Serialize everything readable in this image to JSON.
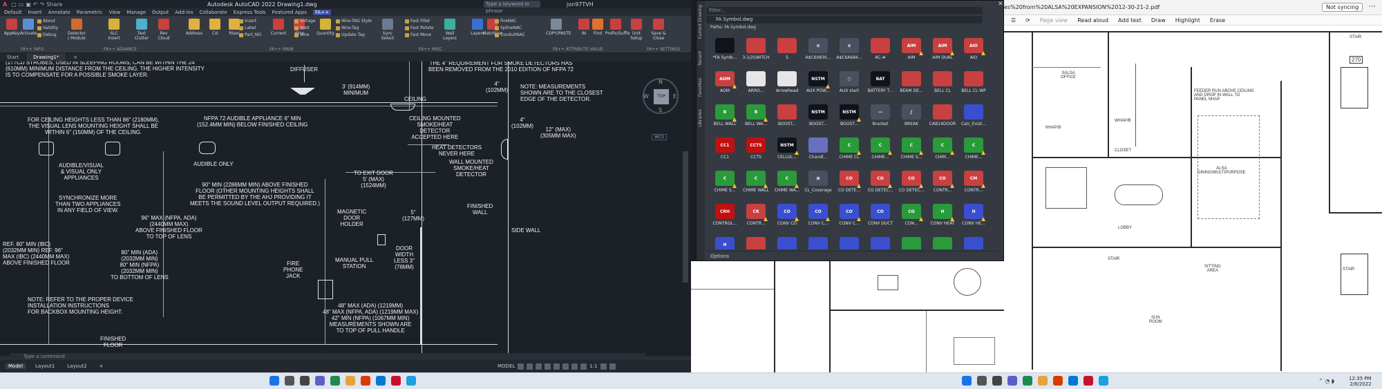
{
  "acad": {
    "title": "Autodesk AutoCAD 2022  Drawing1.dwg",
    "quick_access": [
      "Share"
    ],
    "search_placeholder": "Type a keyword or phrase",
    "user": "jon97TVH",
    "menus": [
      "Default",
      "Insert",
      "Annotate",
      "Parametric",
      "View",
      "Manage",
      "Output",
      "Add-ins",
      "Collaborate",
      "Express Tools",
      "Featured Apps",
      "FA++"
    ],
    "active_menu": "FA++",
    "ribbon_tools": [
      {
        "label": "AppKey",
        "color": "#c94040"
      },
      {
        "label": "Activate",
        "color": "#5a8fd6"
      },
      {
        "label": "Detector / Module",
        "color": "#d46a2b"
      },
      {
        "label": "SLC Insert",
        "color": "#d6b23a"
      },
      {
        "label": "Text Clutter",
        "color": "#4bb0c9"
      },
      {
        "label": "Rev Cloud",
        "color": "#c94040"
      },
      {
        "label": "Address",
        "color": "#e0b040"
      },
      {
        "label": "Cd",
        "color": "#e0b040"
      },
      {
        "label": "Riser",
        "color": "#e0b040"
      },
      {
        "label": "Current",
        "color": "#c94040"
      },
      {
        "label": "Wire",
        "color": "#c94040"
      },
      {
        "label": "Quantity",
        "color": "#d6b23a"
      },
      {
        "label": "Sync Select",
        "color": "#6a7a90"
      },
      {
        "label": "Wall Layers",
        "color": "#3ab0a0"
      },
      {
        "label": "Layers",
        "color": "#3a6fd0"
      },
      {
        "label": "Matchline",
        "color": "#c94040"
      },
      {
        "label": "COPY/PASTE",
        "color": "#7a8a9a"
      },
      {
        "label": "IN",
        "color": "#c94040"
      },
      {
        "label": "Find",
        "color": "#e07030"
      },
      {
        "label": "Prefix/Suffix",
        "color": "#c94040"
      },
      {
        "label": "Unit Setup",
        "color": "#c94040"
      },
      {
        "label": "Save & Close",
        "color": "#c94040"
      }
    ],
    "ribbon_small": [
      "About",
      "Validity",
      "Debug",
      "Insert",
      "Label",
      "Part_NO",
      "Voltage",
      "Watt",
      "Wire",
      "Wire-TAG Style",
      "Wire-Tag",
      "Update Tag",
      "Fast Fillet",
      "Fast Rotate",
      "Fast Move",
      "FireNAC",
      "SplineNAC",
      "ConduitNAC"
    ],
    "panel_labels": [
      "FA++ INFO",
      "FA++ ADVANCE",
      "FA++ MAIN",
      "FA++ MISC",
      "FA++ ATTRIBUTE VALUE",
      "FA++ SETTINGS"
    ],
    "doc_tabs": [
      "Start",
      "Drawing1*"
    ],
    "active_doc_tab": "Drawing1*",
    "viewcube": {
      "top": "TOP",
      "n": "N",
      "s": "S",
      "e": "E",
      "w": "W",
      "wcs": "WCS"
    },
    "command_placeholder": "Type a command",
    "layout_tabs": [
      "Model",
      "Layout1",
      "Layout2"
    ],
    "status_model": "MODEL",
    "scale": "1:1"
  },
  "drawing": {
    "texts": [
      "(177CD STROBES, USED IN SLEEPING ROOMS, CAN BE WITHIN THE 24\"\n(610mm) MINIMUM DISTANCE FROM THE CEILING. THE HIGHER INTENSITY\nIS TO COMPENSATE FOR A POSSIBLE SMOKE LAYER.",
      "DIFFUSER",
      "THE 4\" REQUIREMENT FOR SMOKE DETECTORS HAS\nBEEN REMOVED FROM THE 2010 EDITION OF NFPA 72",
      "3' (914mm)\nMINIMUM",
      "CEILING",
      "4\"\n(102mm)",
      "NOTE: MEASUREMENTS\nSHOWN ARE TO THE CLOSEST\nEDGE OF THE DETECTOR.",
      "FOR CEILING HEIGHTS LESS THAN 86\" (2180mm),\nTHE VISUAL LENS MOUNTING HEIGHT SHALL BE\nWITHIN 6\" (150mm) OF THE CEILING.",
      "NFPA 72 AUDIBLE APPLIANCE 6\" MIN\n(152.4mm MIN) BELOW FINISHED CEILING",
      "CEILING MOUNTED\nSMOKE/HEAT\nDETECTOR\nACCEPTED HERE",
      "4\"\n(102mm)",
      "12\" (MAX)\n(305mm MAX)",
      "HEAT DETECTORS\nNEVER HERE",
      "WALL MOUNTED\nSMOKE/HEAT\nDETECTOR",
      "AUDIBLE/VISUAL\n& VISUAL ONLY\nAPPLIANCES",
      "AUDIBLE ONLY",
      "SYNCHRONIZE MORE\nTHAN TWO APPLIANCES\nIN ANY FIELD OF VIEW.",
      "TO EXIT DOOR\n5' (MAX)\n(1524mm)",
      "90\" MIN (2286mm MIN) ABOVE FINISHED\nFLOOR (OTHER MOUNTING HEIGHTS SHALL\nBE PERMITTED BY THE AHJ PROVIDING IT\nMEETS THE SOUND LEVEL OUTPUT REQUIRED.)",
      "FINISHED\nWALL",
      "5\"\n(127mm)",
      "MAGNETIC\nDOOR\nHOLDER",
      "96\" MAX (NFPA, ADA)\n(2440mm MAX)\nABOVE FINISHED FLOOR\nTO TOP OF LENS",
      "SIDE WALL",
      "REF. 80\" MIN (IBC)\n(2032mm MIN) REF. 96\"\nMAX (IBC) (2440mm MAX)\nABOVE FINISHED FLOOR",
      "80\" MIN (ADA)\n(2032mm MIN)\n80\" MIN (NFPA)\n(2032mm MIN)\nTO BOTTOM OF LENS",
      "DOOR\nWIDTH\nLESS 3\"\n(76mm)",
      "FIRE\nPHONE\nJACK",
      "MANUAL PULL\nSTATION",
      "NOTE: REFER TO THE PROPER DEVICE\nINSTALLATION INSTRUCTIONS\nFOR BACKBOX MOUNTING HEIGHT.",
      "48\" MAX (ADA) (1219mm)\n48\" MAX (NFPA, ADA) (1219mm MAX)\n42\" MIN (NFPA) (1067mm MIN)\nMEASUREMENTS SHOWN ARE\nTO TOP OF PULL HANDLE",
      "FINISHED\nFLOOR"
    ]
  },
  "palette": {
    "side_tabs": [
      "Current Drawing",
      "Recent",
      "Favorites",
      "Libraries"
    ],
    "filter_placeholder": "Filter...",
    "path": "FA Symbol.dwg",
    "paths_label": "Paths: FA Symbol.dwg",
    "options_label": "Options",
    "symbols": [
      {
        "label": "*FA Symb...",
        "color": "#10131a",
        "tag": false,
        "text": ""
      },
      {
        "label": "3-1/2SWITCH",
        "color": "#c94040",
        "tag": false,
        "text": ""
      },
      {
        "label": "5",
        "color": "#c94040",
        "tag": false,
        "text": ""
      },
      {
        "label": "A$C60830...",
        "color": "#4a5060",
        "tag": false,
        "text": "⊘"
      },
      {
        "label": "A$C6A684...",
        "color": "#4a5060",
        "tag": false,
        "text": "⊘"
      },
      {
        "label": "AC-#",
        "color": "#c94040",
        "tag": false,
        "text": ""
      },
      {
        "label": "AIM",
        "color": "#c94040",
        "tag": true,
        "text": "AIM"
      },
      {
        "label": "AIM DUAL",
        "color": "#c94040",
        "tag": true,
        "text": "AIM"
      },
      {
        "label": "AIO",
        "color": "#c94040",
        "tag": true,
        "text": "AIO"
      },
      {
        "label": "AOM",
        "color": "#c94040",
        "tag": true,
        "text": "AOM"
      },
      {
        "label": "ARRO...",
        "color": "#e6e6e6",
        "tag": false,
        "text": ""
      },
      {
        "label": "Arrowhead",
        "color": "#e6e6e6",
        "tag": false,
        "text": ""
      },
      {
        "label": "AUX POW...",
        "color": "#10131a",
        "tag": true,
        "text": "NSTM"
      },
      {
        "label": "AUX start",
        "color": "#4a5060",
        "tag": false,
        "text": "○"
      },
      {
        "label": "BATTERY T...",
        "color": "#10131a",
        "tag": false,
        "text": "BAT"
      },
      {
        "label": "BEAM DE...",
        "color": "#c94040",
        "tag": false,
        "text": ""
      },
      {
        "label": "BELL CL",
        "color": "#c94040",
        "tag": false,
        "text": ""
      },
      {
        "label": "BELL CL WP",
        "color": "#c94040",
        "tag": false,
        "text": ""
      },
      {
        "label": "BELL WALL",
        "color": "#2a9a3a",
        "tag": true,
        "text": "B"
      },
      {
        "label": "BELL WA...",
        "color": "#2a9a3a",
        "tag": true,
        "text": "B"
      },
      {
        "label": "BOOST...",
        "color": "#c94040",
        "tag": false,
        "text": ""
      },
      {
        "label": "BOOST...",
        "color": "#10131a",
        "tag": false,
        "text": "NSTM"
      },
      {
        "label": "BOOST...",
        "color": "#10131a",
        "tag": true,
        "text": "NSTM"
      },
      {
        "label": "Bracket",
        "color": "#4a5060",
        "tag": false,
        "text": "—"
      },
      {
        "label": "BREAK",
        "color": "#4a5060",
        "tag": false,
        "text": "∫"
      },
      {
        "label": "CAB14DOOR",
        "color": "#c94040",
        "tag": false,
        "text": ""
      },
      {
        "label": "Calc_Exist...",
        "color": "#3a4fd0",
        "tag": false,
        "text": ""
      },
      {
        "label": "CC1",
        "color": "#c01010",
        "tag": false,
        "text": "CC1"
      },
      {
        "label": "CCTS",
        "color": "#c01010",
        "tag": false,
        "text": "CCTS"
      },
      {
        "label": "CELLUL...",
        "color": "#10131a",
        "tag": true,
        "text": "NSTM"
      },
      {
        "label": "Chandl...",
        "color": "#6a70c0",
        "tag": false,
        "text": ""
      },
      {
        "label": "CHIME CL",
        "color": "#2a9a3a",
        "tag": true,
        "text": "C"
      },
      {
        "label": "CHIME...",
        "color": "#2a9a3a",
        "tag": true,
        "text": "C"
      },
      {
        "label": "CHIME S...",
        "color": "#2a9a3a",
        "tag": true,
        "text": "C"
      },
      {
        "label": "CHIM...",
        "color": "#2a9a3a",
        "tag": true,
        "text": "C"
      },
      {
        "label": "CHIME...",
        "color": "#2a9a3a",
        "tag": true,
        "text": "C"
      },
      {
        "label": "CHIME S...",
        "color": "#2a9a3a",
        "tag": true,
        "text": "C"
      },
      {
        "label": "CHIME WALL",
        "color": "#2a9a3a",
        "tag": true,
        "text": "C"
      },
      {
        "label": "CHIME WA...",
        "color": "#2a9a3a",
        "tag": true,
        "text": "C"
      },
      {
        "label": "CL_Coverage",
        "color": "#4a5060",
        "tag": false,
        "text": "⊞"
      },
      {
        "label": "CO DETE...",
        "color": "#c94040",
        "tag": true,
        "text": "CO"
      },
      {
        "label": "CO DETEC...",
        "color": "#c94040",
        "tag": true,
        "text": "CO"
      },
      {
        "label": "CO DETEC...",
        "color": "#c94040",
        "tag": true,
        "text": "CO"
      },
      {
        "label": "CONTR...",
        "color": "#c94040",
        "tag": true,
        "text": "CO"
      },
      {
        "label": "CONTR...",
        "color": "#c94040",
        "tag": true,
        "text": "CM"
      },
      {
        "label": "CONTROL...",
        "color": "#c01010",
        "tag": false,
        "text": "CRH"
      },
      {
        "label": "CONTR...",
        "color": "#c94040",
        "tag": true,
        "text": "CR"
      },
      {
        "label": "CONV CO",
        "color": "#3a4fd0",
        "tag": true,
        "text": "CO"
      },
      {
        "label": "CONV C...",
        "color": "#3a4fd0",
        "tag": true,
        "text": "CO"
      },
      {
        "label": "CONV C...",
        "color": "#3a4fd0",
        "tag": true,
        "text": "CO"
      },
      {
        "label": "CONV DUCT",
        "color": "#3a4fd0",
        "tag": false,
        "text": "CO"
      },
      {
        "label": "CON...",
        "color": "#2a9a3a",
        "tag": true,
        "text": "CO"
      },
      {
        "label": "CONV HEAT",
        "color": "#2a9a3a",
        "tag": true,
        "text": "H"
      },
      {
        "label": "CONV HE...",
        "color": "#3a4fd0",
        "tag": true,
        "text": "H"
      },
      {
        "label": "CONV HE...",
        "color": "#3a4fd0",
        "tag": true,
        "text": "H"
      },
      {
        "label": "",
        "color": "#c94040",
        "tag": true,
        "text": ""
      },
      {
        "label": "",
        "color": "#3a4fd0",
        "tag": true,
        "text": ""
      },
      {
        "label": "",
        "color": "#3a4fd0",
        "tag": true,
        "text": ""
      },
      {
        "label": "",
        "color": "#3a4fd0",
        "tag": true,
        "text": ""
      },
      {
        "label": "",
        "color": "#3a4fd0",
        "tag": true,
        "text": ""
      },
      {
        "label": "",
        "color": "#2a9a3a",
        "tag": true,
        "text": ""
      },
      {
        "label": "",
        "color": "#2a9a3a",
        "tag": true,
        "text": ""
      },
      {
        "label": "",
        "color": "#3a4fd0",
        "tag": true,
        "text": ""
      },
      {
        "label": "",
        "color": "#c01010",
        "tag": false,
        "text": ""
      }
    ]
  },
  "pdf": {
    "url": "es%20from%20ALSA%20EXPANSION%2012-30-21-2.pdf",
    "sync_label": "Not syncing",
    "toolbar": [
      "Page view",
      "Read aloud",
      "Add text",
      "Draw",
      "Highlight",
      "Erase"
    ],
    "page_labels": [
      "SALSA\nOFFICE",
      "STAIR",
      "270",
      "CLOSET",
      "ALSA\nDINING/MULTIPURPOSE",
      "FEEDER RUN ABOVE CEILING\nAND DROP IN WALL TO\nPANEL NHAP",
      "LOBBY",
      "STAIR",
      "SITTING\nAREA",
      "SUN\nROOM",
      "STAIR",
      "WHAP/B",
      "NHAP/B"
    ]
  },
  "taskbar": {
    "time": "12:35 PM",
    "date": "2/8/2022"
  }
}
